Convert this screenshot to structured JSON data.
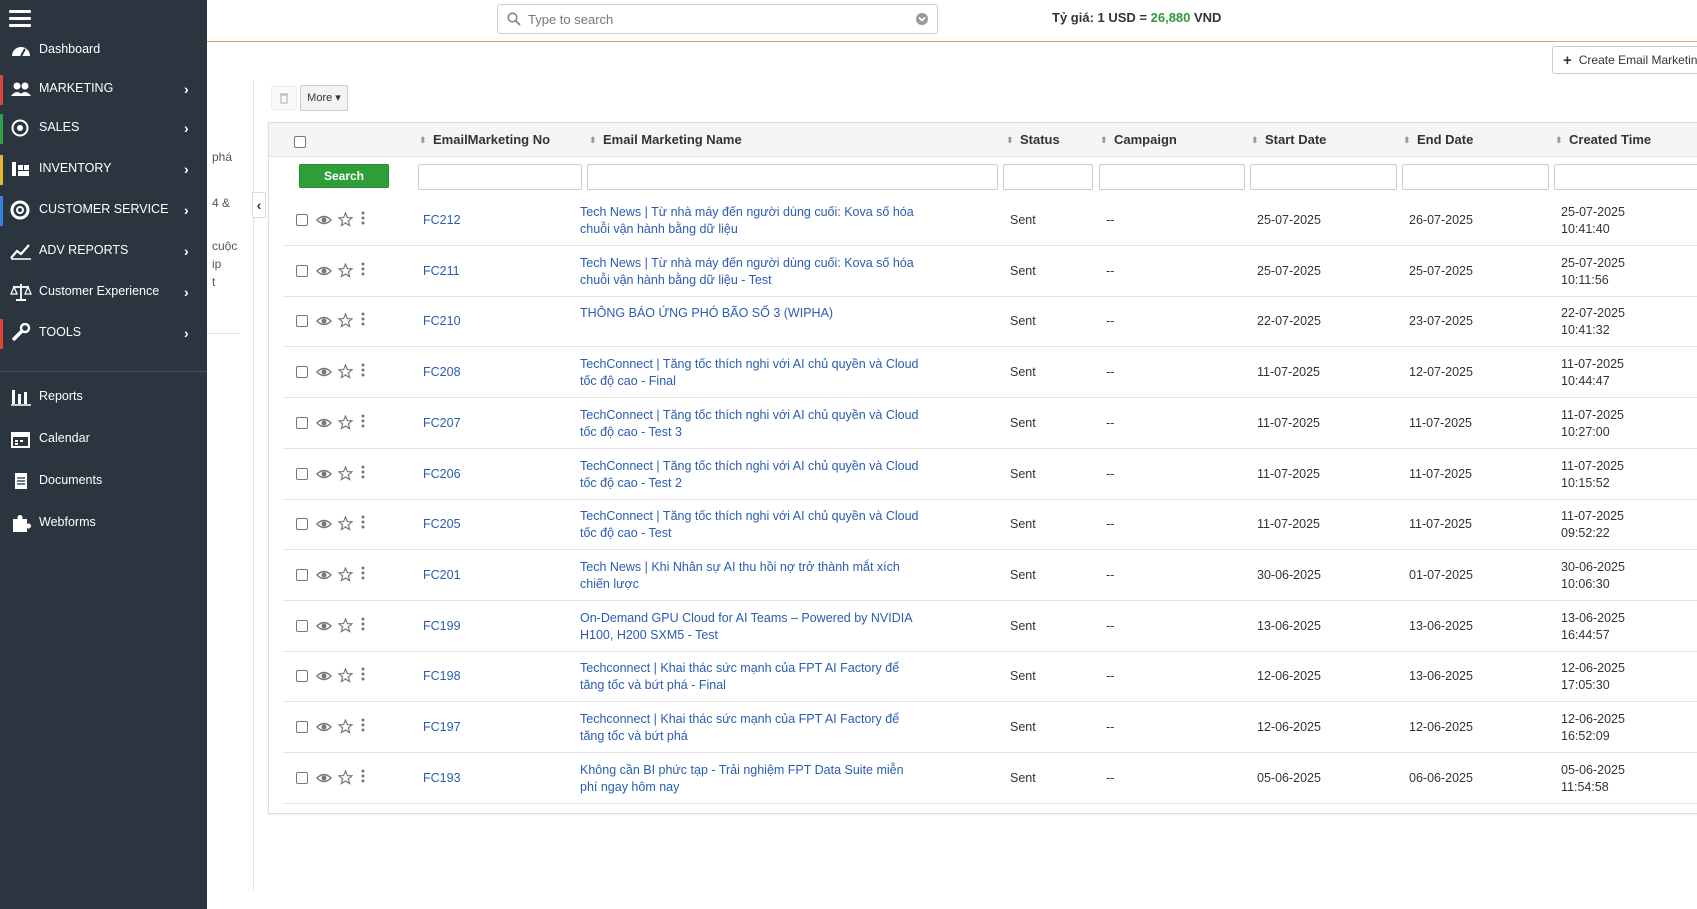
{
  "sidebar": {
    "items": [
      {
        "label": "Dashboard",
        "icon": "dashboard-icon",
        "accent": ""
      },
      {
        "label": "MARKETING",
        "icon": "users-icon",
        "accent": "#e0453a"
      },
      {
        "label": "SALES",
        "icon": "target-icon",
        "accent": "#2ea34a"
      },
      {
        "label": "INVENTORY",
        "icon": "inventory-icon",
        "accent": "#e5b92b"
      },
      {
        "label": "CUSTOMER SERVICE",
        "icon": "lifebuoy-icon",
        "accent": "#3a7fd9"
      },
      {
        "label": "ADV REPORTS",
        "icon": "chart-line-icon",
        "accent": ""
      },
      {
        "label": "Customer Experience",
        "icon": "scale-icon",
        "accent": ""
      },
      {
        "label": "TOOLS",
        "icon": "wrench-icon",
        "accent": "#e0453a"
      }
    ],
    "secondary": [
      {
        "label": "Reports",
        "icon": "bar-chart-icon"
      },
      {
        "label": "Calendar",
        "icon": "calendar-icon"
      },
      {
        "label": "Documents",
        "icon": "documents-icon"
      },
      {
        "label": "Webforms",
        "icon": "puzzle-icon"
      }
    ],
    "arrow": "›"
  },
  "header": {
    "search_placeholder": "Type to search",
    "exchange_prefix": "Tỷ giá: 1 USD = ",
    "exchange_rate": "26,880",
    "exchange_suffix": " VND"
  },
  "create_button_label": "Create Email Marketing",
  "left_strip_fragments": [
    "phá",
    "4 &",
    "cuộc",
    "ip",
    "t"
  ],
  "toolbar": {
    "more_label": "More ▾"
  },
  "table": {
    "columns": [
      "EmailMarketing No",
      "Email Marketing Name",
      "Status",
      "Campaign",
      "Start Date",
      "End Date",
      "Created Time"
    ],
    "search_label": "Search",
    "rows": [
      {
        "no": "FC212",
        "name": "Tech News | Từ nhà máy đến người dùng cuối: Kova số hóa chuỗi vận hành bằng dữ liệu",
        "status": "Sent",
        "campaign": "--",
        "start": "25-07-2025",
        "end": "26-07-2025",
        "created_date": "25-07-2025",
        "created_time": "10:41:40"
      },
      {
        "no": "FC211",
        "name": "Tech News | Từ nhà máy đến người dùng cuối: Kova số hóa chuỗi vận hành bằng dữ liệu - Test",
        "status": "Sent",
        "campaign": "--",
        "start": "25-07-2025",
        "end": "25-07-2025",
        "created_date": "25-07-2025",
        "created_time": "10:11:56"
      },
      {
        "no": "FC210",
        "name": "THÔNG BÁO ỨNG PHÓ BÃO SỐ 3 (WIPHA)",
        "status": "Sent",
        "campaign": "--",
        "start": "22-07-2025",
        "end": "23-07-2025",
        "created_date": "22-07-2025",
        "created_time": "10:41:32"
      },
      {
        "no": "FC208",
        "name": "TechConnect | Tăng tốc thích nghi với AI chủ quyền và Cloud tốc độ cao - Final",
        "status": "Sent",
        "campaign": "--",
        "start": "11-07-2025",
        "end": "12-07-2025",
        "created_date": "11-07-2025",
        "created_time": "10:44:47"
      },
      {
        "no": "FC207",
        "name": "TechConnect | Tăng tốc thích nghi với AI chủ quyền và Cloud tốc độ cao - Test 3",
        "status": "Sent",
        "campaign": "--",
        "start": "11-07-2025",
        "end": "11-07-2025",
        "created_date": "11-07-2025",
        "created_time": "10:27:00"
      },
      {
        "no": "FC206",
        "name": "TechConnect | Tăng tốc thích nghi với AI chủ quyền và Cloud tốc độ cao - Test 2",
        "status": "Sent",
        "campaign": "--",
        "start": "11-07-2025",
        "end": "11-07-2025",
        "created_date": "11-07-2025",
        "created_time": "10:15:52"
      },
      {
        "no": "FC205",
        "name": "TechConnect | Tăng tốc thích nghi với AI chủ quyền và Cloud tốc độ cao - Test",
        "status": "Sent",
        "campaign": "--",
        "start": "11-07-2025",
        "end": "11-07-2025",
        "created_date": "11-07-2025",
        "created_time": "09:52:22"
      },
      {
        "no": "FC201",
        "name": "Tech News | Khi Nhân sự AI thu hồi nợ trở thành mắt xích chiến lược",
        "status": "Sent",
        "campaign": "--",
        "start": "30-06-2025",
        "end": "01-07-2025",
        "created_date": "30-06-2025",
        "created_time": "10:06:30"
      },
      {
        "no": "FC199",
        "name": "On-Demand GPU Cloud for AI Teams – Powered by NVIDIA H100, H200 SXM5 - Test",
        "status": "Sent",
        "campaign": "--",
        "start": "13-06-2025",
        "end": "13-06-2025",
        "created_date": "13-06-2025",
        "created_time": "16:44:57"
      },
      {
        "no": "FC198",
        "name": "Techconnect | Khai thác sức mạnh của FPT AI Factory để tăng tốc và bứt phá - Final",
        "status": "Sent",
        "campaign": "--",
        "start": "12-06-2025",
        "end": "13-06-2025",
        "created_date": "12-06-2025",
        "created_time": "17:05:30"
      },
      {
        "no": "FC197",
        "name": "Techconnect | Khai thác sức mạnh của FPT AI Factory để tăng tốc và bứt phá",
        "status": "Sent",
        "campaign": "--",
        "start": "12-06-2025",
        "end": "12-06-2025",
        "created_date": "12-06-2025",
        "created_time": "16:52:09"
      },
      {
        "no": "FC193",
        "name": "Không cần BI phức tạp - Trải nghiệm FPT Data Suite miễn phí ngay hôm nay",
        "status": "Sent",
        "campaign": "--",
        "start": "05-06-2025",
        "end": "06-06-2025",
        "created_date": "05-06-2025",
        "created_time": "11:54:58"
      }
    ]
  },
  "colors": {
    "sidebar_bg": "#2a3540",
    "search_button": "#2f9e3a",
    "link": "#2a5db0",
    "rate": "#2e9a3a",
    "topbar_border": "#d9a679"
  }
}
